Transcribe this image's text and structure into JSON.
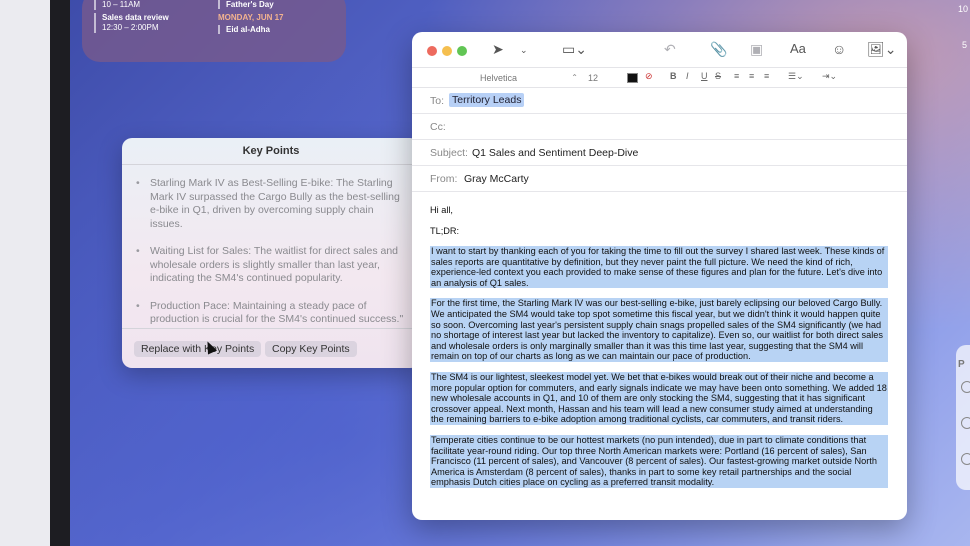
{
  "calendar": {
    "events_left": [
      {
        "time": "10 – 11AM",
        "title": ""
      },
      {
        "title": "Sales data review",
        "time": "12:30 – 2:00PM"
      }
    ],
    "events_right_top": "Father's Day",
    "day_heading": "MONDAY, JUN 17",
    "holiday": "Eid al-Adha"
  },
  "edge": {
    "top_line1": "10",
    "top_line2": "5",
    "panel_letter": "P"
  },
  "key_points": {
    "title": "Key Points",
    "items": [
      "Starling Mark IV as Best-Selling E-bike: The Starling Mark IV surpassed the Cargo Bully as the best-selling e-bike in Q1, driven by overcoming supply chain issues.",
      "Waiting List for Sales: The waitlist for direct sales and wholesale orders is slightly smaller than last year, indicating the SM4's continued popularity.",
      "Production Pace: Maintaining a steady pace of production is crucial for the SM4's continued success.\""
    ],
    "replace_button": "Replace with Key Points",
    "copy_button": "Copy Key Points"
  },
  "mail": {
    "toolbar_icons": [
      "send-icon",
      "chevron-down-icon",
      "header-fields-icon",
      "reply-icon",
      "attachment-icon",
      "markup-icon",
      "format-text-icon",
      "emoji-icon",
      "photo-browser-icon"
    ],
    "format": {
      "font": "Helvetica",
      "size": "12",
      "bold": "B",
      "italic": "I",
      "underline": "U",
      "strike": "S"
    },
    "to_label": "To:",
    "to_value": "Territory Leads",
    "cc_label": "Cc:",
    "subject_label": "Subject:",
    "subject_value": "Q1 Sales and Sentiment Deep-Dive",
    "from_label": "From:",
    "from_value": "Gray McCarty",
    "greeting": "Hi all,",
    "tldr": "TL;DR:",
    "paragraphs": [
      "I want to start by thanking each of you for taking the time to fill out the survey I shared last week. These kinds of sales reports are quantitative by definition, but they never paint the full picture. We need the kind of rich, experience-led context you each provided to make sense of these figures and plan for the future. Let's dive into an analysis of Q1 sales.",
      "For the first time, the Starling Mark IV was our best-selling e-bike, just barely eclipsing our beloved Cargo Bully. We anticipated the SM4 would take top spot sometime this fiscal year, but we didn't think it would happen quite so soon. Overcoming last year's persistent supply chain snags propelled sales of the SM4 significantly (we had no shortage of interest last year but lacked the inventory to capitalize). Even so, our waitlist for both direct sales and wholesale orders is only marginally smaller than it was this time last year, suggesting that the SM4 will remain on top of our charts as long as we can maintain our pace of production.",
      "The SM4 is our lightest, sleekest model yet. We bet that e-bikes would break out of their niche and become a more popular option for commuters, and early signals indicate we may have been onto something. We added 18 new wholesale accounts in Q1, and 10 of them are only stocking the SM4, suggesting that it has significant crossover appeal. Next month, Hassan and his team will lead a new consumer study aimed at understanding the remaining barriers to e-bike adoption among traditional cyclists, car commuters, and transit riders.",
      "Temperate cities continue to be our hottest markets (no pun intended), due in part to climate conditions that facilitate year-round riding. Our top three North American markets were: Portland (16 percent of sales), San Francisco (11 percent of sales), and Vancouver (8 percent of sales). Our fastest-growing market outside North America is Amsterdam (8 percent of sales), thanks in part to some key retail partnerships and the social emphasis Dutch cities place on cycling as a preferred transit modality."
    ]
  },
  "colors": {
    "selection": "#b8d3f4",
    "to_chip": "#b7d0f6",
    "close": "#ed6a5e",
    "minimize": "#f5bf4f",
    "zoom": "#61c554"
  }
}
